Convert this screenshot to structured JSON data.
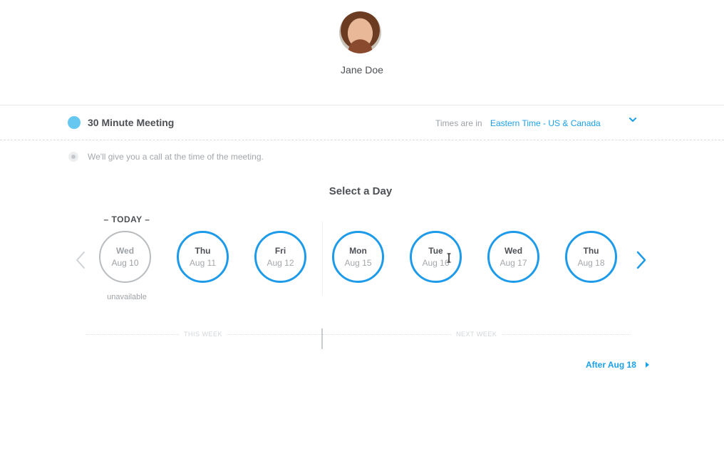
{
  "host": {
    "name": "Jane Doe"
  },
  "event": {
    "title": "30 Minute Meeting",
    "accent_color": "#66c8f1"
  },
  "timezone": {
    "label": "Times are in",
    "value": "Eastern Time - US & Canada"
  },
  "call_note": "We'll give you a call at the time of the meeting.",
  "picker": {
    "title": "Select a Day",
    "today_label": "– TODAY –",
    "unavailable_label": "unavailable",
    "accent_color": "#1d9bea",
    "days": [
      {
        "dow": "Wed",
        "date": "Aug 10",
        "available": false
      },
      {
        "dow": "Thu",
        "date": "Aug 11",
        "available": true
      },
      {
        "dow": "Fri",
        "date": "Aug 12",
        "available": true
      },
      {
        "dow": "Mon",
        "date": "Aug 15",
        "available": true
      },
      {
        "dow": "Tue",
        "date": "Aug 16",
        "available": true
      },
      {
        "dow": "Wed",
        "date": "Aug 17",
        "available": true
      },
      {
        "dow": "Thu",
        "date": "Aug 18",
        "available": true
      }
    ],
    "this_week_label": "THIS WEEK",
    "next_week_label": "NEXT WEEK",
    "after_link": "After Aug 18"
  },
  "icons": {
    "avatar": "avatar-photo",
    "timezone_toggle": "chevron-down-icon",
    "prev": "chevron-left-icon",
    "next": "chevron-right-icon",
    "call": "phone-icon",
    "after": "caret-right-icon"
  }
}
